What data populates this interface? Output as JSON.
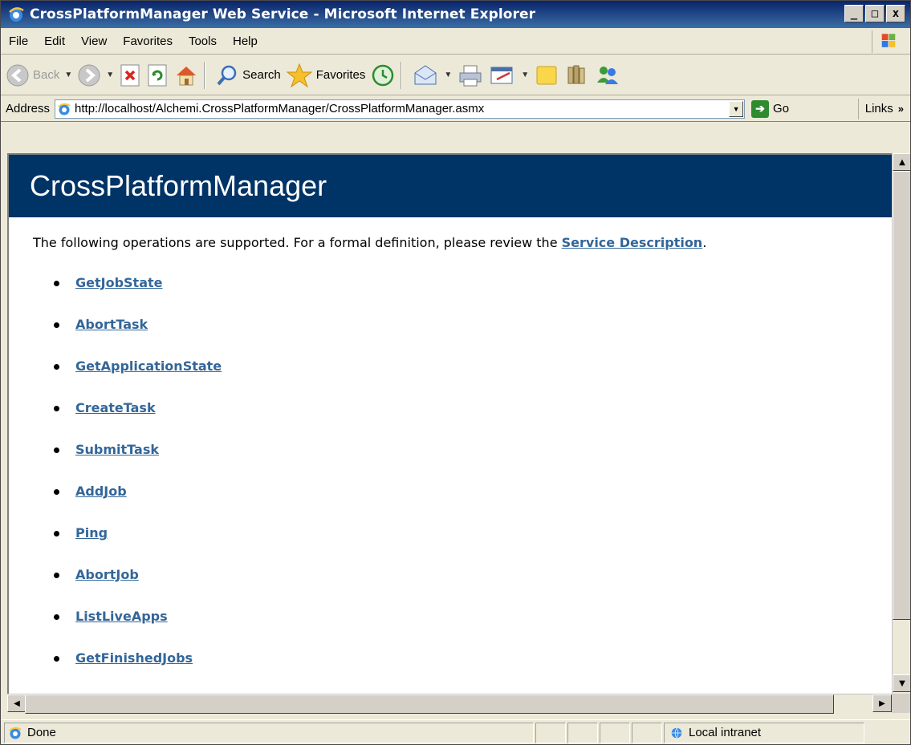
{
  "window": {
    "title": "CrossPlatformManager Web Service - Microsoft Internet Explorer",
    "controls": [
      "_",
      "□",
      "x"
    ]
  },
  "menu": [
    "File",
    "Edit",
    "View",
    "Favorites",
    "Tools",
    "Help"
  ],
  "toolbar": {
    "back_label": "Back",
    "search_label": "Search",
    "favorites_label": "Favorites"
  },
  "address": {
    "label": "Address",
    "url": "http://localhost/Alchemi.CrossPlatformManager/CrossPlatformManager.asmx",
    "go_label": "Go",
    "links_label": "Links"
  },
  "page": {
    "banner_title": "CrossPlatformManager",
    "intro_before": "The following operations are supported. For a formal definition, please review the ",
    "intro_link": "Service Description",
    "intro_after": ".",
    "operations": [
      "GetJobState",
      "AbortTask",
      "GetApplicationState",
      "CreateTask",
      "SubmitTask",
      "AddJob",
      "Ping",
      "AbortJob",
      "ListLiveApps",
      "GetFinishedJobs"
    ]
  },
  "status": {
    "text": "Done",
    "zone": "Local intranet"
  },
  "colors": {
    "banner": "#003366",
    "link": "#336699",
    "chrome": "#ece9d8"
  }
}
